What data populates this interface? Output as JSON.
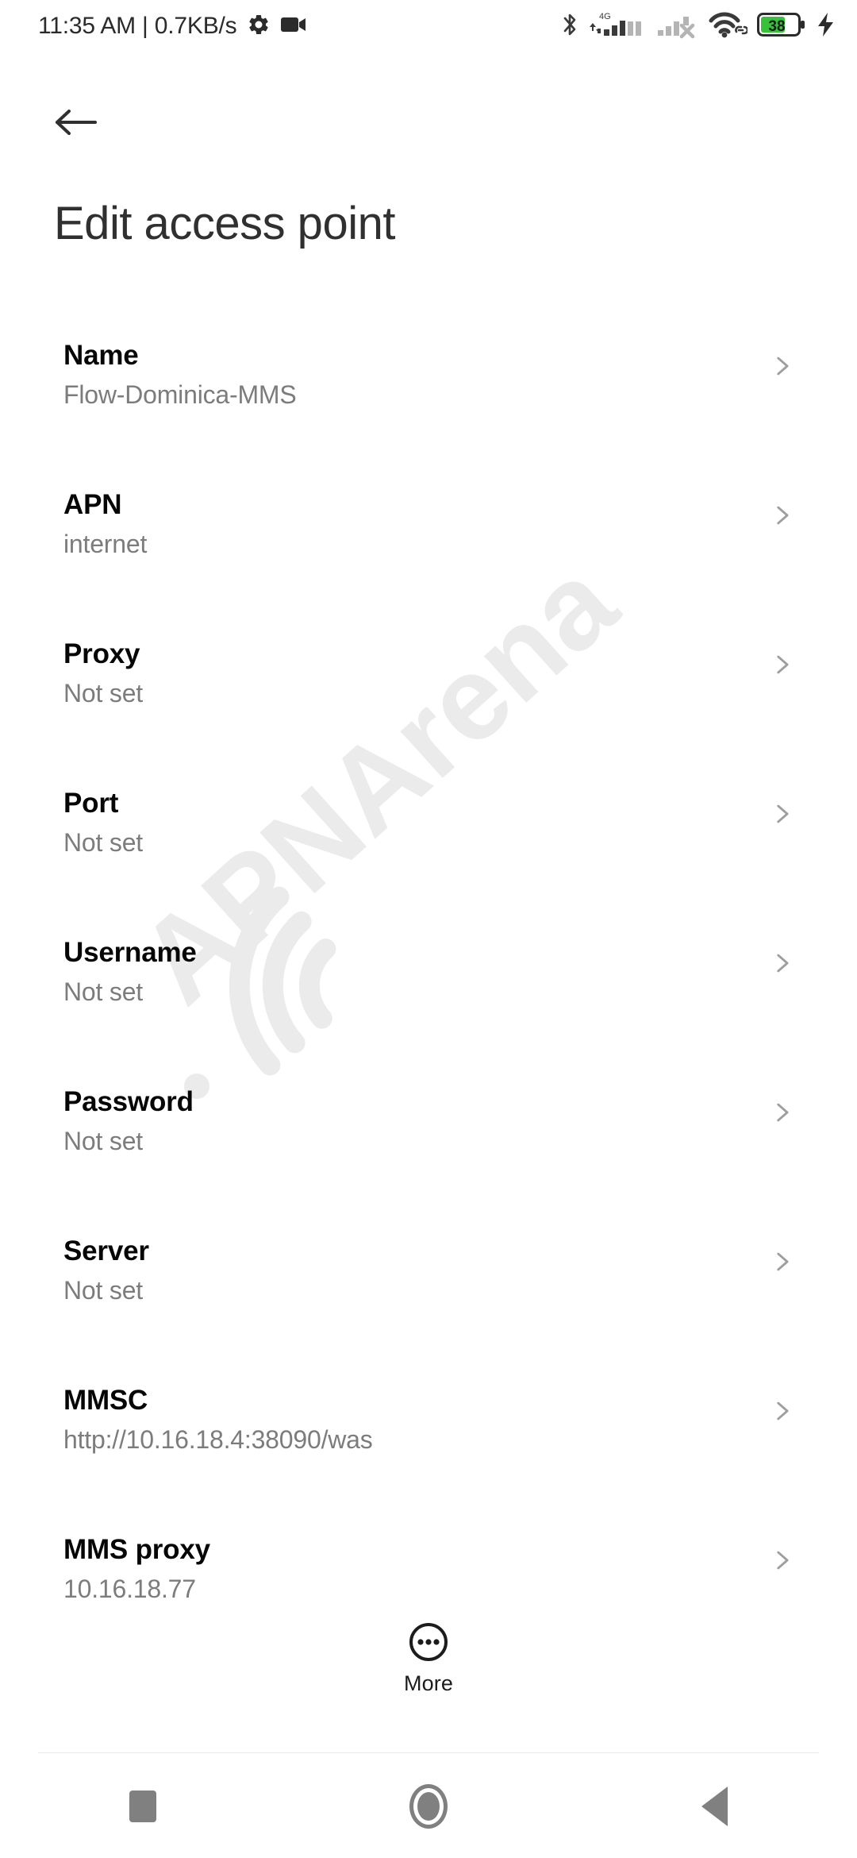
{
  "status_bar": {
    "clock": "11:35 AM | 0.7KB/s",
    "icons": {
      "settings": "gear-icon",
      "screen_record": "video-camera-icon",
      "bluetooth": "bluetooth-icon",
      "network_type": "4G",
      "sim1_signal": "signal-bars-icon",
      "sim2_signal": "signal-bars-no-service-icon",
      "wifi": "wifi-icon",
      "vpn": "link-icon",
      "battery": "battery-icon",
      "charging": "charging-bolt-icon"
    },
    "battery_level": "38"
  },
  "header": {
    "back_icon": "arrow-left-icon",
    "title": "Edit access point"
  },
  "watermark": {
    "text": "APNArena",
    "color": "#ebebeb"
  },
  "preferences": [
    {
      "title": "Name",
      "value": "Flow-Dominica-MMS"
    },
    {
      "title": "APN",
      "value": "internet"
    },
    {
      "title": "Proxy",
      "value": "Not set"
    },
    {
      "title": "Port",
      "value": "Not set"
    },
    {
      "title": "Username",
      "value": "Not set"
    },
    {
      "title": "Password",
      "value": "Not set"
    },
    {
      "title": "Server",
      "value": "Not set"
    },
    {
      "title": "MMSC",
      "value": "http://10.16.18.4:38090/was"
    },
    {
      "title": "MMS proxy",
      "value": "10.16.18.77"
    }
  ],
  "more_button": {
    "label": "More",
    "icon": "more-circle-icon"
  },
  "nav_bar": {
    "recents": "recents-square-icon",
    "home": "home-circle-icon",
    "back": "back-triangle-icon"
  },
  "colors": {
    "background": "#ffffff",
    "title_text": "#303030",
    "pref_title": "#060606",
    "pref_value": "#7c7c7c",
    "chevron": "#9e9e9e",
    "nav_icon": "#808080",
    "battery_fill": "#38c23c"
  }
}
